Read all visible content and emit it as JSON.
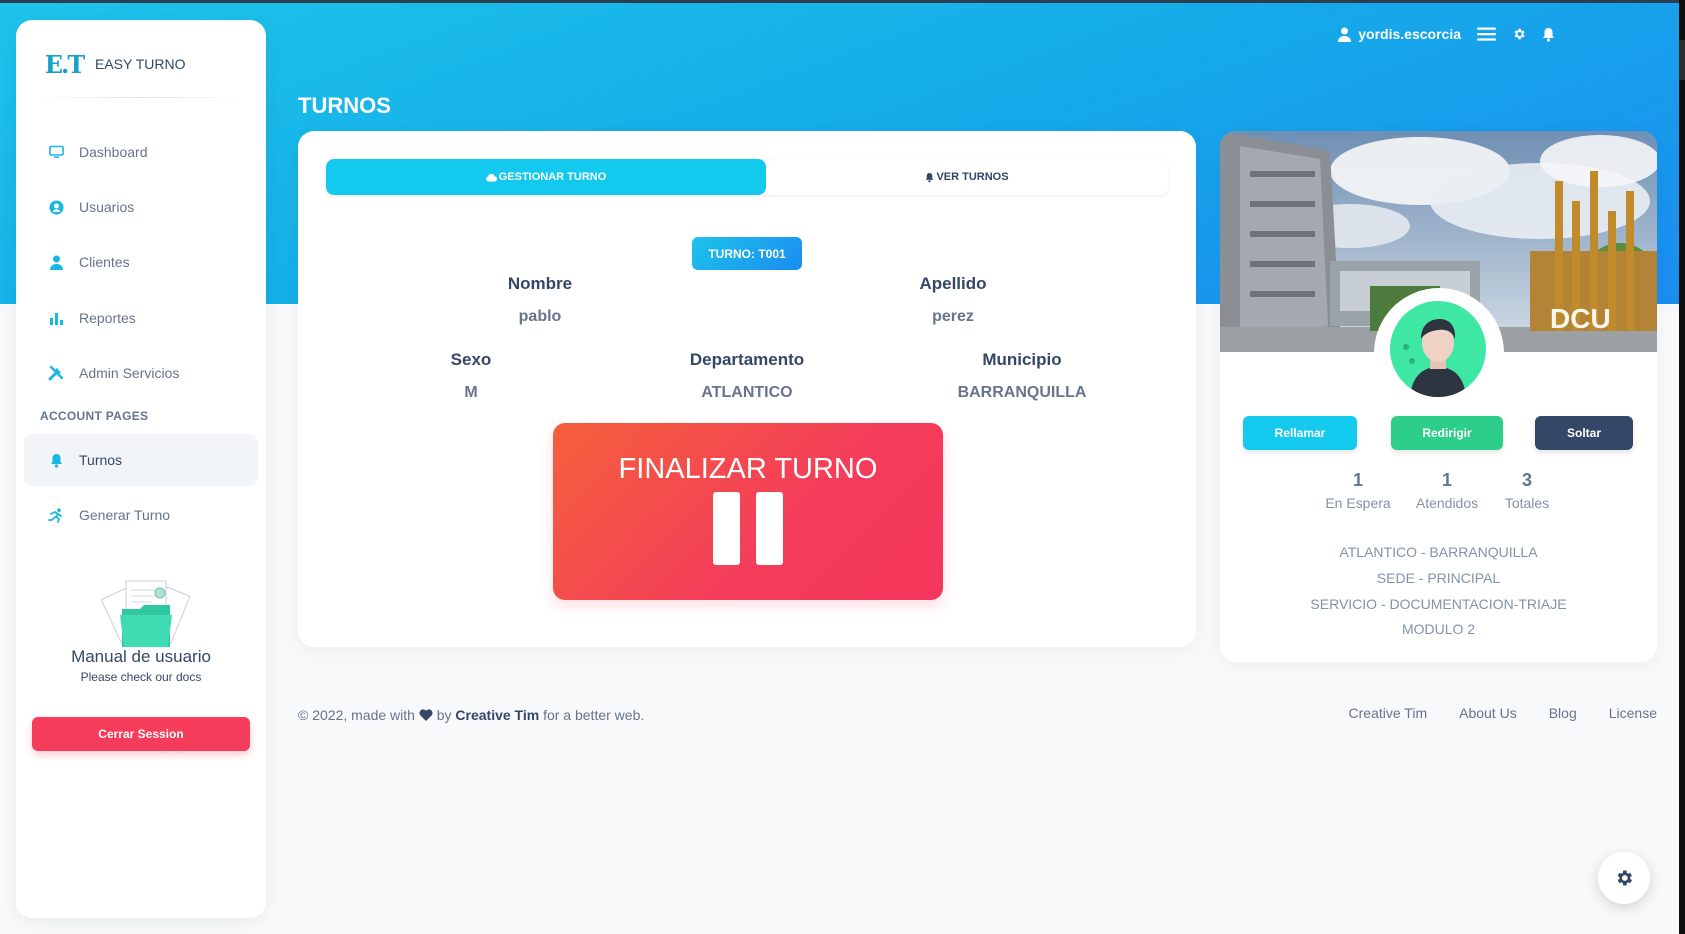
{
  "brand": {
    "logo": "E.T",
    "name": "EASY TURNO"
  },
  "sidebar": {
    "items": [
      {
        "label": "Dashboard",
        "icon": "monitor-icon"
      },
      {
        "label": "Usuarios",
        "icon": "user-circle-icon"
      },
      {
        "label": "Clientes",
        "icon": "user-icon"
      },
      {
        "label": "Reportes",
        "icon": "bar-chart-icon"
      },
      {
        "label": "Admin Servicios",
        "icon": "tools-icon"
      }
    ],
    "section_title": "ACCOUNT PAGES",
    "account_items": [
      {
        "label": "Turnos",
        "icon": "bell-icon",
        "active": true
      },
      {
        "label": "Generar Turno",
        "icon": "running-icon"
      }
    ],
    "docs": {
      "title": "Manual de usuario",
      "subtitle": "Please check our docs"
    },
    "logout_label": "Cerrar Session"
  },
  "topnav": {
    "username": "yordis.escorcia"
  },
  "page": {
    "title": "TURNOS"
  },
  "tabs": [
    {
      "label": "GESTIONAR TURNO",
      "active": true
    },
    {
      "label": "VER TURNOS",
      "active": false
    }
  ],
  "turn": {
    "badge": "TURNO: T001",
    "fields": {
      "nombre": {
        "label": "Nombre",
        "value": "pablo"
      },
      "apellido": {
        "label": "Apellido",
        "value": "perez"
      },
      "sexo": {
        "label": "Sexo",
        "value": "M"
      },
      "departamento": {
        "label": "Departamento",
        "value": "ATLANTICO"
      },
      "municipio": {
        "label": "Municipio",
        "value": "BARRANQUILLA"
      }
    },
    "finish_label": "FINALIZAR TURNO"
  },
  "profile": {
    "cover_text": "DCU",
    "buttons": {
      "rellamar": "Rellamar",
      "redirigir": "Redirigir",
      "soltar": "Soltar"
    },
    "stats": [
      {
        "value": "1",
        "label": "En Espera"
      },
      {
        "value": "1",
        "label": "Atendidos"
      },
      {
        "value": "3",
        "label": "Totales"
      }
    ],
    "info": [
      "ATLANTICO - BARRANQUILLA",
      "SEDE - PRINCIPAL",
      "SERVICIO - DOCUMENTACION-TRIAJE",
      "MODULO 2"
    ]
  },
  "footer": {
    "prefix": "© 2022, made with",
    "by": "by",
    "author": "Creative Tim",
    "suffix": "for a better web.",
    "links": [
      "Creative Tim",
      "About Us",
      "Blog",
      "License"
    ]
  },
  "colors": {
    "primary": "#14c9ee",
    "danger": "#f53c5b",
    "success": "#2dce89",
    "dark": "#344767"
  }
}
